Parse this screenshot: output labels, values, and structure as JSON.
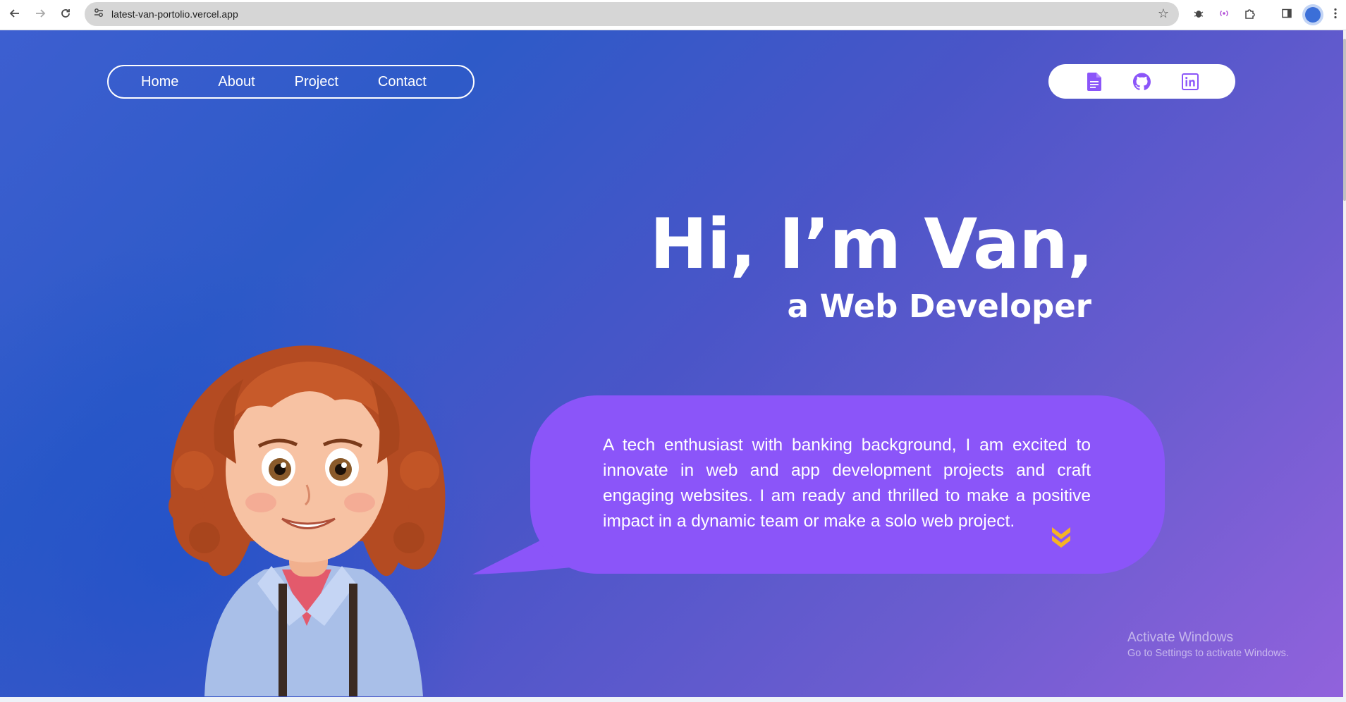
{
  "browser": {
    "url": "latest-van-portolio.vercel.app",
    "back_icon": "back-arrow-icon",
    "forward_icon": "forward-arrow-icon",
    "reload_icon": "reload-icon"
  },
  "nav": {
    "items": [
      {
        "label": "Home"
      },
      {
        "label": "About"
      },
      {
        "label": "Project"
      },
      {
        "label": "Contact"
      }
    ]
  },
  "social": {
    "icons": [
      "document-icon",
      "github-icon",
      "linkedin-icon"
    ],
    "icon_color": "#8b55f9"
  },
  "hero": {
    "title": "Hi, I’m Van,",
    "subtitle": "a Web Developer",
    "bio": "A tech enthusiast with banking background, I am excited to innovate in web and app development projects and craft engaging websites. I am ready and thrilled to make a positive impact in a dynamic team or make a solo web project.",
    "bubble_color": "#8b55f9",
    "chevron_color": "#f5b324"
  },
  "watermark": {
    "title": "Activate Windows",
    "subtitle": "Go to Settings to activate Windows."
  }
}
